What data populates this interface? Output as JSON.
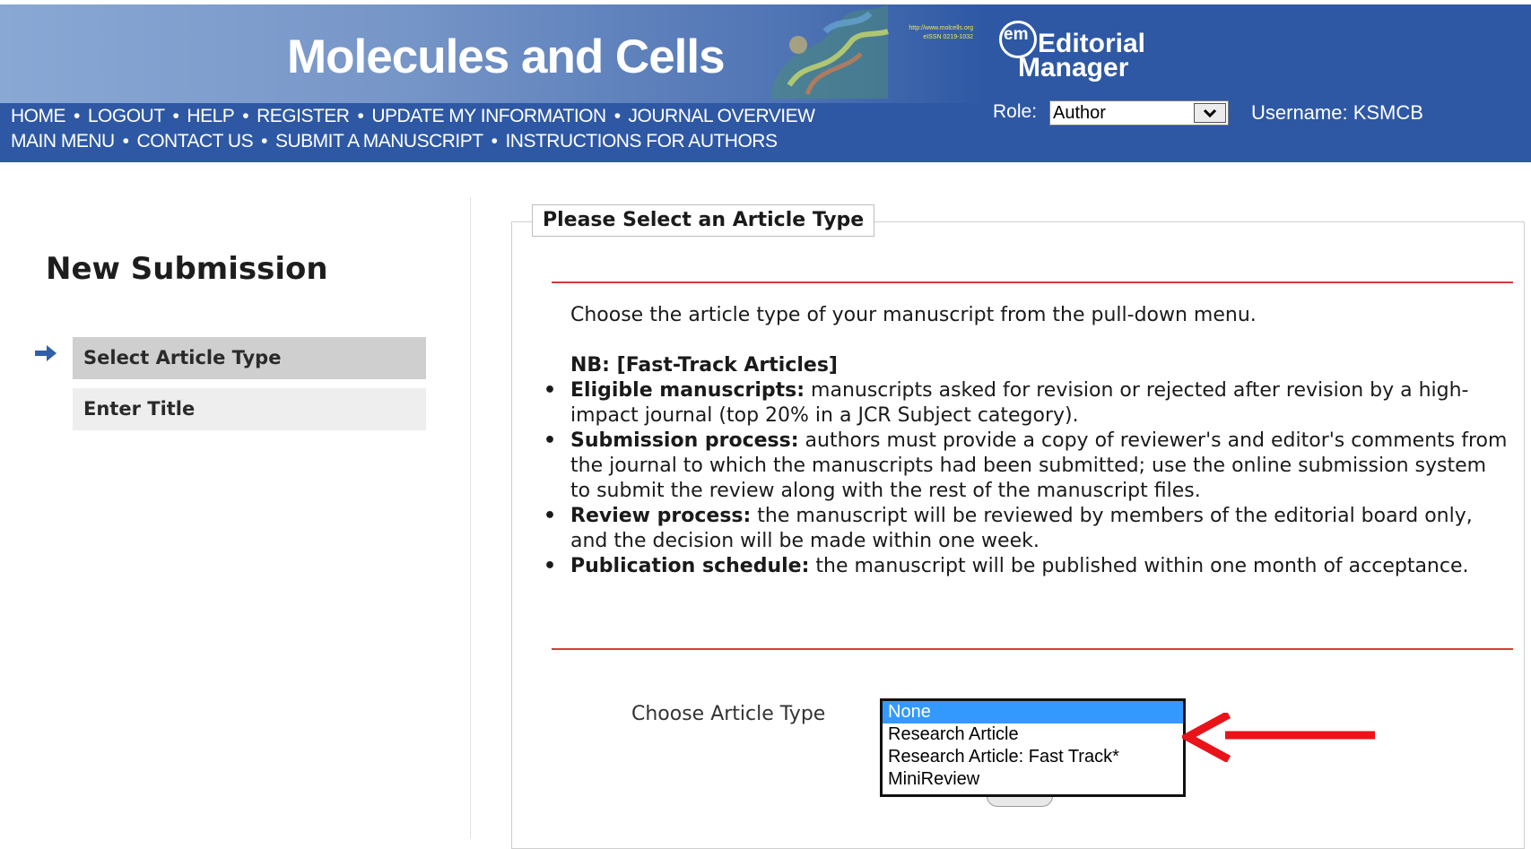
{
  "header": {
    "journal_title": "Molecules and Cells",
    "banner_url_line1": "http://www.molcells.org",
    "banner_url_line2": "eISSN 0219-1032",
    "logo_em": "em",
    "logo_editorial": "Editorial",
    "logo_manager": "Manager",
    "nav_row1": [
      {
        "label": "HOME"
      },
      {
        "label": "LOGOUT"
      },
      {
        "label": "HELP"
      },
      {
        "label": "REGISTER"
      },
      {
        "label": "UPDATE MY INFORMATION"
      },
      {
        "label": "JOURNAL OVERVIEW"
      }
    ],
    "nav_row2": [
      {
        "label": "MAIN MENU"
      },
      {
        "label": "CONTACT US"
      },
      {
        "label": "SUBMIT A MANUSCRIPT"
      },
      {
        "label": "INSTRUCTIONS FOR AUTHORS"
      }
    ],
    "role_label": "Role:",
    "role_value": "Author",
    "username": "Username: KSMCB"
  },
  "sidebar": {
    "title": "New Submission",
    "steps": [
      {
        "label": "Select Article Type",
        "current": true
      },
      {
        "label": "Enter Title",
        "current": false
      }
    ]
  },
  "main": {
    "legend": "Please Select an Article Type",
    "intro": "Choose the article type of your manuscript from the pull-down menu.",
    "nb": "NB: [Fast-Track Articles]",
    "bullets": [
      {
        "term": "Eligible manuscripts:",
        "text": " manuscripts asked for revision or rejected after revision by a high-impact journal (top 20% in a JCR Subject category)."
      },
      {
        "term": "Submission process:",
        "text": " authors must provide a copy of reviewer's and editor's comments from the journal to which the manuscripts had been submitted; use the online submission system to submit the review along with the rest of the manuscript files."
      },
      {
        "term": "Review process:",
        "text": " the manuscript will be reviewed by members of the editorial board only, and the decision will be made within one week."
      },
      {
        "term": "Publication schedule:",
        "text": " the manuscript will be published within one month of acceptance."
      }
    ],
    "choose_label": "Choose Article Type",
    "options": [
      "None",
      "Research Article",
      "Research Article: Fast Track*",
      "MiniReview"
    ],
    "selected_option": "None"
  },
  "colors": {
    "header_bg": "#2e58a4",
    "accent_red": "#d23b3b",
    "arrow_red": "#e8141a",
    "selected_option_bg": "#3399ff"
  },
  "icons": {
    "current_step": "arrow-right-icon",
    "dropdown": "chevron-down-icon",
    "annotation": "red-arrow-icon"
  }
}
